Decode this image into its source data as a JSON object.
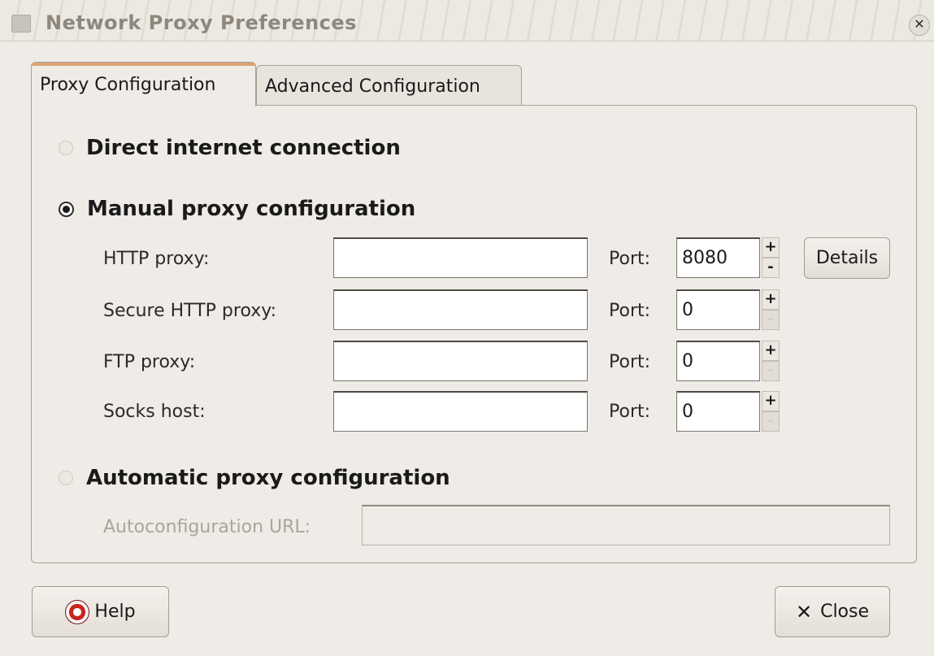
{
  "window": {
    "title": "Network Proxy Preferences",
    "close_icon": "✕"
  },
  "tabs": [
    {
      "label": "Proxy Configuration"
    },
    {
      "label": "Advanced Configuration"
    }
  ],
  "modes": {
    "direct": {
      "label": "Direct internet connection"
    },
    "manual": {
      "label": "Manual proxy configuration"
    },
    "automatic": {
      "label": "Automatic proxy configuration"
    }
  },
  "manual": {
    "port_label": "Port:",
    "rows": [
      {
        "label": "HTTP proxy:",
        "value": "",
        "port": "8080"
      },
      {
        "label": "Secure HTTP proxy:",
        "value": "",
        "port": "0"
      },
      {
        "label": "FTP proxy:",
        "value": "",
        "port": "0"
      },
      {
        "label": "Socks host:",
        "value": "",
        "port": "0"
      }
    ],
    "details_label": "Details",
    "spin_up": "+",
    "spin_down": "-"
  },
  "automatic": {
    "url_label": "Autoconfiguration URL:",
    "url_value": ""
  },
  "buttons": {
    "help": "Help",
    "close": "Close",
    "close_glyph": "✕"
  }
}
